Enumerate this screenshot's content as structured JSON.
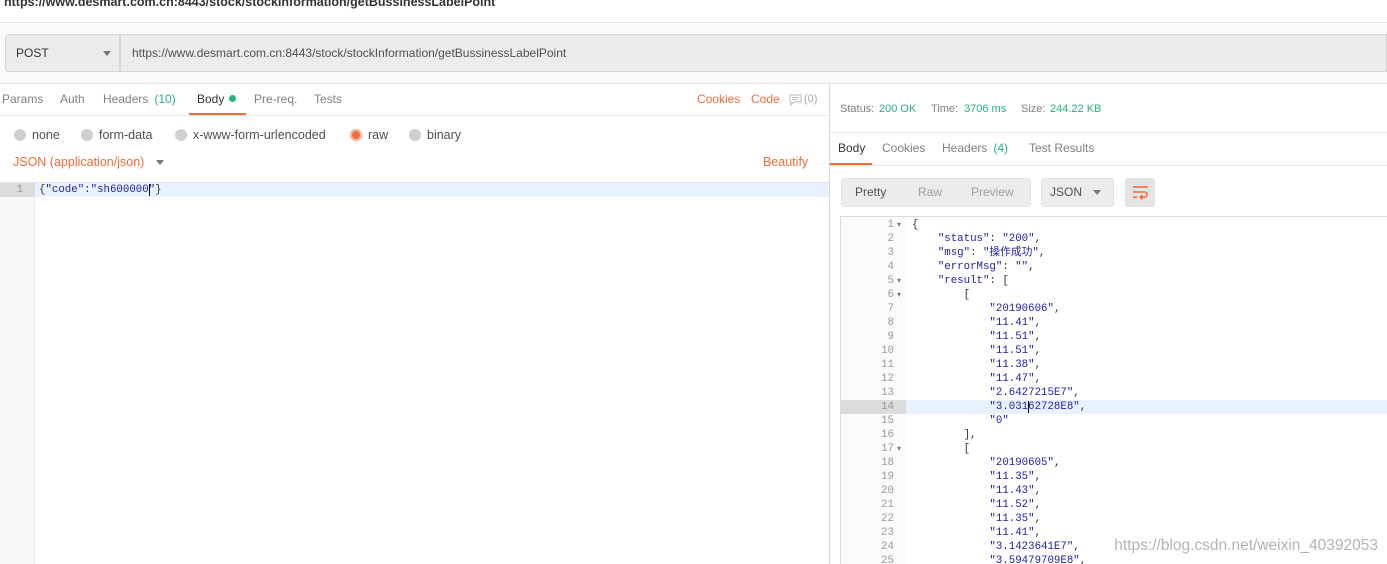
{
  "page_title": "https://www.desmart.com.cn:8443/stock/stockInformation/getBussinessLabelPoint",
  "request": {
    "method": "POST",
    "url": "https://www.desmart.com.cn:8443/stock/stockInformation/getBussinessLabelPoint"
  },
  "request_tabs": {
    "params": "Params",
    "auth": "Auth",
    "headers": "Headers",
    "headers_count": "(10)",
    "body": "Body",
    "prereq": "Pre-req.",
    "tests": "Tests",
    "active": "Body"
  },
  "request_links": {
    "cookies": "Cookies",
    "code": "Code",
    "comments_count": "(0)"
  },
  "body_modes": {
    "none": "none",
    "form_data": "form-data",
    "urlencoded": "x-www-form-urlencoded",
    "raw": "raw",
    "binary": "binary",
    "selected": "raw"
  },
  "body_type": "JSON (application/json)",
  "beautify": "Beautify",
  "request_body": {
    "lines": [
      {
        "n": "1",
        "text": "{\"code\":\"sh600000\"}",
        "active": true
      }
    ]
  },
  "response": {
    "status_label": "Status:",
    "status": "200 OK",
    "time_label": "Time:",
    "time": "3706 ms",
    "size_label": "Size:",
    "size": "244.22 KB"
  },
  "response_tabs": {
    "body": "Body",
    "cookies": "Cookies",
    "headers": "Headers",
    "headers_count": "(4)",
    "test_results": "Test Results",
    "active": "Body"
  },
  "view_modes": {
    "pretty": "Pretty",
    "raw": "Raw",
    "preview": "Preview",
    "selected": "Pretty"
  },
  "response_format": "JSON",
  "wrap_icon": "wrap-lines-icon",
  "response_body": {
    "lines": [
      {
        "n": "1",
        "text": "{",
        "fold": true
      },
      {
        "n": "2",
        "text": "    \"status\": \"200\","
      },
      {
        "n": "3",
        "text": "    \"msg\": \"操作成功\","
      },
      {
        "n": "4",
        "text": "    \"errorMsg\": \"\","
      },
      {
        "n": "5",
        "text": "    \"result\": [",
        "fold": true
      },
      {
        "n": "6",
        "text": "        [",
        "fold": true
      },
      {
        "n": "7",
        "text": "            \"20190606\","
      },
      {
        "n": "8",
        "text": "            \"11.41\","
      },
      {
        "n": "9",
        "text": "            \"11.51\","
      },
      {
        "n": "10",
        "text": "            \"11.51\","
      },
      {
        "n": "11",
        "text": "            \"11.38\","
      },
      {
        "n": "12",
        "text": "            \"11.47\","
      },
      {
        "n": "13",
        "text": "            \"2.6427215E7\","
      },
      {
        "n": "14",
        "text": "            \"3.03162728E8\",",
        "active": true
      },
      {
        "n": "15",
        "text": "            \"0\""
      },
      {
        "n": "16",
        "text": "        ],"
      },
      {
        "n": "17",
        "text": "        [",
        "fold": true
      },
      {
        "n": "18",
        "text": "            \"20190605\","
      },
      {
        "n": "19",
        "text": "            \"11.35\","
      },
      {
        "n": "20",
        "text": "            \"11.43\","
      },
      {
        "n": "21",
        "text": "            \"11.52\","
      },
      {
        "n": "22",
        "text": "            \"11.35\","
      },
      {
        "n": "23",
        "text": "            \"11.41\","
      },
      {
        "n": "24",
        "text": "            \"3.1423641E7\","
      },
      {
        "n": "25",
        "text": "            \"3.59479709E8\","
      }
    ]
  },
  "watermark": "https://blog.csdn.net/weixin_40392053",
  "colors": {
    "accent": "#f26b3a",
    "success": "#26b47f",
    "string": "#1f1fa0"
  }
}
